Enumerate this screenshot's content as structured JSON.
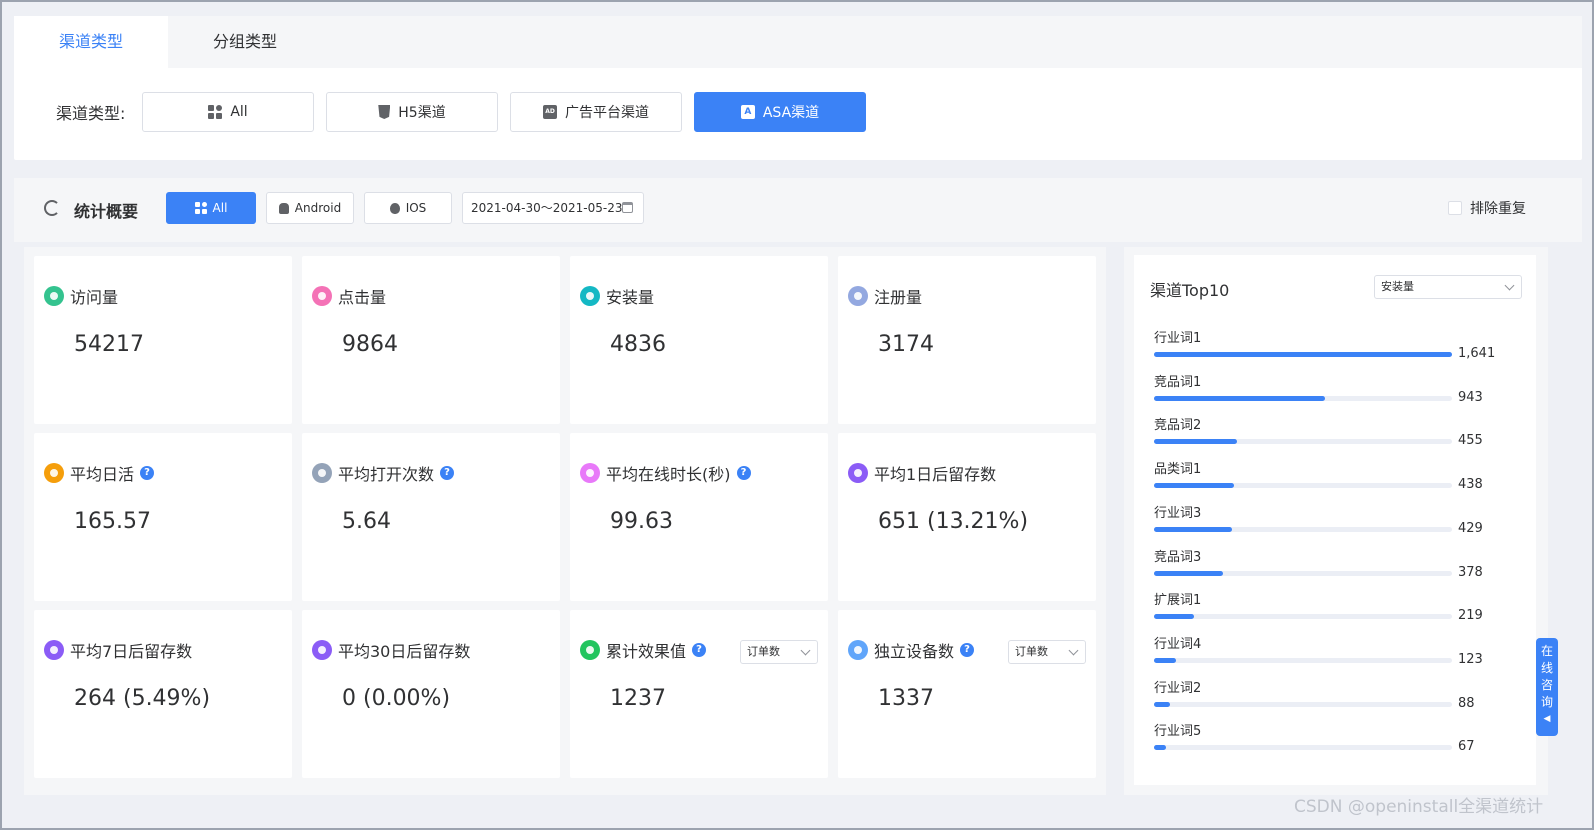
{
  "tabs": {
    "channel": "渠道类型",
    "group": "分组类型"
  },
  "channel_filter": {
    "label": "渠道类型:",
    "buttons": {
      "all": "All",
      "h5": "H5渠道",
      "ad": "广告平台渠道",
      "asa": "ASA渠道"
    },
    "active": "ASA渠道"
  },
  "stats": {
    "title": "统计概要",
    "platforms": {
      "all": "All",
      "android": "Android",
      "ios": "IOS"
    },
    "date_range": "2021-04-30～2021-05-23",
    "dedup_label": "排除重复",
    "ad_icon_text": "AD"
  },
  "metrics": [
    {
      "label": "访问量",
      "value": "54217",
      "color": "#34c38f"
    },
    {
      "label": "点击量",
      "value": "9864",
      "color": "#f472b6"
    },
    {
      "label": "安装量",
      "value": "4836",
      "color": "#14b8c4"
    },
    {
      "label": "注册量",
      "value": "3174",
      "color": "#93a8e0"
    },
    {
      "label": "平均日活",
      "value": "165.57",
      "color": "#f59e0b",
      "help": "?"
    },
    {
      "label": "平均打开次数",
      "value": "5.64",
      "color": "#94a3b8",
      "help": "?"
    },
    {
      "label": "平均在线时长(秒)",
      "value": "99.63",
      "color": "#e879f9",
      "help": "?"
    },
    {
      "label": "平均1日后留存数",
      "value": "651 (13.21%)",
      "color": "#8b5cf6"
    },
    {
      "label": "平均7日后留存数",
      "value": "264 (5.49%)",
      "color": "#8b5cf6"
    },
    {
      "label": "平均30日后留存数",
      "value": "0 (0.00%)",
      "color": "#8b5cf6"
    },
    {
      "label": "累计效果值",
      "value": "1237",
      "color": "#22c55e",
      "help": "?",
      "select": "订单数"
    },
    {
      "label": "独立设备数",
      "value": "1337",
      "color": "#60a5fa",
      "help": "?",
      "select": "订单数"
    }
  ],
  "top10": {
    "title": "渠道Top10",
    "select": "安装量",
    "max": 1641,
    "items": [
      {
        "label": "行业词1",
        "value": 1641,
        "display": "1,641"
      },
      {
        "label": "竞品词1",
        "value": 943,
        "display": "943"
      },
      {
        "label": "竞品词2",
        "value": 455,
        "display": "455"
      },
      {
        "label": "品类词1",
        "value": 438,
        "display": "438"
      },
      {
        "label": "行业词3",
        "value": 429,
        "display": "429"
      },
      {
        "label": "竞品词3",
        "value": 378,
        "display": "378"
      },
      {
        "label": "扩展词1",
        "value": 219,
        "display": "219"
      },
      {
        "label": "行业词4",
        "value": 123,
        "display": "123"
      },
      {
        "label": "行业词2",
        "value": 88,
        "display": "88"
      },
      {
        "label": "行业词5",
        "value": 67,
        "display": "67"
      }
    ]
  },
  "consult": {
    "chars": [
      "在",
      "线",
      "咨",
      "询"
    ],
    "arrow": "◀"
  },
  "watermark": "CSDN @openinstall全渠道统计"
}
